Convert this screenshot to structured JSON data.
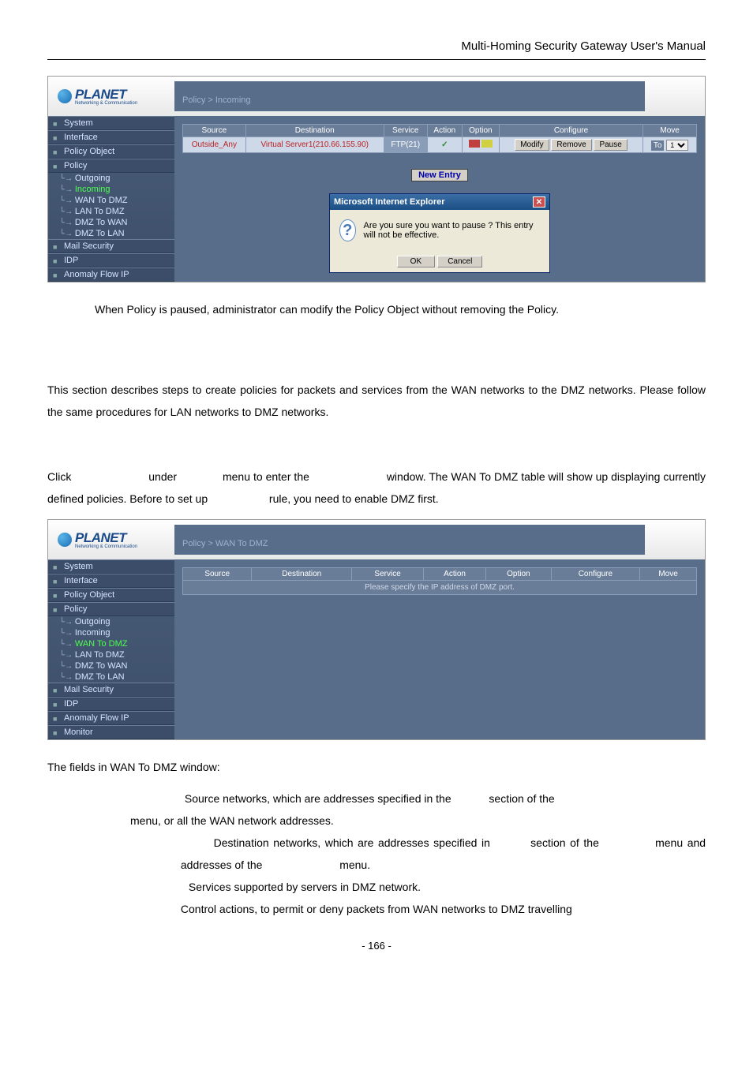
{
  "header": {
    "title": "Multi-Homing Security Gateway User's Manual"
  },
  "logo": {
    "brand": "PLANET",
    "tagline": "Networking & Communication"
  },
  "screenshot1": {
    "breadcrumb": "Policy > Incoming",
    "sidebar": {
      "items": [
        {
          "label": "System",
          "type": "header"
        },
        {
          "label": "Interface",
          "type": "header"
        },
        {
          "label": "Policy Object",
          "type": "header"
        },
        {
          "label": "Policy",
          "type": "header",
          "active_group": true
        },
        {
          "label": "Outgoing",
          "type": "sub"
        },
        {
          "label": "Incoming",
          "type": "sub",
          "active": true
        },
        {
          "label": "WAN To DMZ",
          "type": "sub"
        },
        {
          "label": "LAN To DMZ",
          "type": "sub"
        },
        {
          "label": "DMZ To WAN",
          "type": "sub"
        },
        {
          "label": "DMZ To LAN",
          "type": "sub"
        },
        {
          "label": "Mail Security",
          "type": "header"
        },
        {
          "label": "IDP",
          "type": "header"
        },
        {
          "label": "Anomaly Flow IP",
          "type": "header"
        }
      ]
    },
    "table": {
      "headers": [
        "Source",
        "Destination",
        "Service",
        "Action",
        "Option",
        "Configure",
        "Move"
      ],
      "row": {
        "source": "Outside_Any",
        "destination": "Virtual Server1(210.66.155.90)",
        "service": "FTP(21)",
        "configure": {
          "modify": "Modify",
          "remove": "Remove",
          "pause": "Pause"
        },
        "move": {
          "to": "To",
          "value": "1"
        }
      }
    },
    "new_entry": "New Entry",
    "dialog": {
      "title": "Microsoft Internet Explorer",
      "message": "Are you sure you want to pause ? This entry will not be effective.",
      "ok": "OK",
      "cancel": "Cancel"
    }
  },
  "note1": "When Policy is paused, administrator can modify the Policy Object without removing the Policy.",
  "para1": "This section describes steps to create policies for packets and services from the WAN networks to the DMZ networks. Please follow the same procedures for LAN networks to DMZ networks.",
  "para2": {
    "p1": "Click",
    "p2": "under",
    "p3": "menu to enter the",
    "p4": "window. The WAN To DMZ table will show up displaying currently defined policies. Before to set up",
    "p5": "rule, you need to enable DMZ first."
  },
  "screenshot2": {
    "breadcrumb": "Policy > WAN To DMZ",
    "sidebar": {
      "items": [
        {
          "label": "System",
          "type": "header"
        },
        {
          "label": "Interface",
          "type": "header"
        },
        {
          "label": "Policy Object",
          "type": "header"
        },
        {
          "label": "Policy",
          "type": "header",
          "active_group": true
        },
        {
          "label": "Outgoing",
          "type": "sub"
        },
        {
          "label": "Incoming",
          "type": "sub"
        },
        {
          "label": "WAN To DMZ",
          "type": "sub",
          "active": true
        },
        {
          "label": "LAN To DMZ",
          "type": "sub"
        },
        {
          "label": "DMZ To WAN",
          "type": "sub"
        },
        {
          "label": "DMZ To LAN",
          "type": "sub"
        },
        {
          "label": "Mail Security",
          "type": "header"
        },
        {
          "label": "IDP",
          "type": "header"
        },
        {
          "label": "Anomaly Flow IP",
          "type": "header"
        },
        {
          "label": "Monitor",
          "type": "header"
        }
      ]
    },
    "table": {
      "headers": [
        "Source",
        "Destination",
        "Service",
        "Action",
        "Option",
        "Configure",
        "Move"
      ],
      "placeholder": "Please specify the IP address of DMZ port."
    }
  },
  "fields_intro": "The fields in WAN To DMZ window:",
  "defs": {
    "d1a": "Source networks, which are addresses specified in the",
    "d1b": "section of the",
    "d1c": "menu, or all the WAN network addresses.",
    "d2a": "Destination networks, which are addresses specified in",
    "d2b": "section of the",
    "d2c": "menu and",
    "d2d": "addresses of the",
    "d2e": "menu.",
    "d3": "Services supported by servers in DMZ network.",
    "d4": "Control actions, to permit or deny packets from WAN networks to DMZ travelling"
  },
  "footer": {
    "page": "- 166 -"
  }
}
